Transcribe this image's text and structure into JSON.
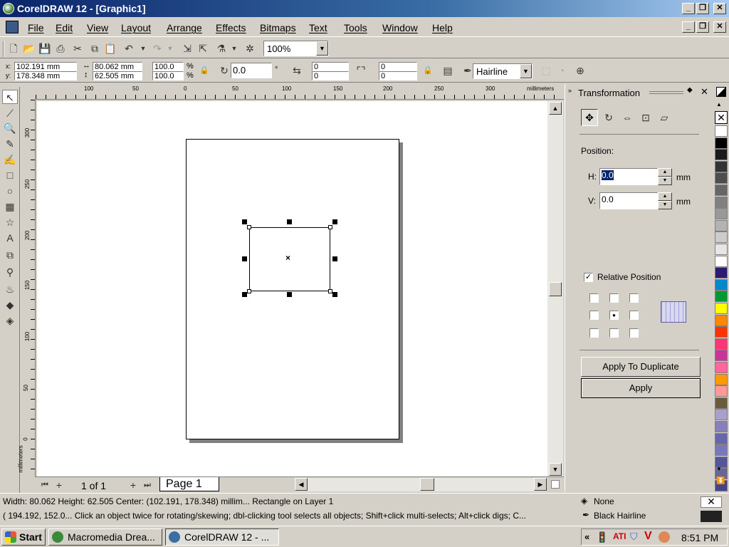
{
  "window": {
    "title": "CorelDRAW 12 - [Graphic1]"
  },
  "menu": [
    "File",
    "Edit",
    "View",
    "Layout",
    "Arrange",
    "Effects",
    "Bitmaps",
    "Text",
    "Tools",
    "Window",
    "Help"
  ],
  "toolbar": {
    "zoom": "100%"
  },
  "propbar": {
    "x": "102.191 mm",
    "y": "178.348 mm",
    "w": "80.062 mm",
    "h": "62.505 mm",
    "scale_x": "100.0",
    "scale_y": "100.0",
    "pct": "%",
    "rotation": "0.0",
    "degree": "°",
    "corner_a": "0",
    "corner_b": "0",
    "corner_c": "0",
    "corner_d": "0",
    "outline": "Hairline"
  },
  "ruler": {
    "h_ticks": [
      "100",
      "50",
      "0",
      "50",
      "100",
      "150",
      "200",
      "250",
      "300"
    ],
    "h_unit": "millimeters",
    "v_ticks": [
      "300",
      "250",
      "200",
      "150",
      "100",
      "50",
      "0"
    ],
    "v_unit": "millimeters"
  },
  "page_nav": {
    "counter": "1 of 1",
    "tab": "Page 1"
  },
  "docker": {
    "title": "Transformation",
    "position_label": "Position:",
    "h_label": "H:",
    "h_value": "0.0",
    "h_unit": "mm",
    "v_label": "V:",
    "v_value": "0.0",
    "v_unit": "mm",
    "relative_label": "Relative Position",
    "apply_dup": "Apply To Duplicate",
    "apply": "Apply"
  },
  "palette": [
    "#ffffff",
    "#000000",
    "#1a1a1a",
    "#333333",
    "#4d4d4d",
    "#666666",
    "#808080",
    "#999999",
    "#b3b3b3",
    "#cccccc",
    "#e6e6e6",
    "#ffffff",
    "#2e1a6e",
    "#0088cc",
    "#009933",
    "#ffff00",
    "#ff8800",
    "#ff3300",
    "#ff3377",
    "#cc3399",
    "#ff6699",
    "#ff9900",
    "#ff9999",
    "#6b5b3d",
    "#aaa0cc",
    "#8880bb",
    "#6666aa",
    "#7777bb",
    "#555599",
    "#666699",
    "#444488"
  ],
  "status": {
    "line1": "Width: 80.062  Height: 62.505  Center: (102.191, 178.348)  millim...  Rectangle on Layer 1",
    "line2": "( 194.192, 152.0...   Click an object twice for rotating/skewing; dbl-clicking tool selects all objects; Shift+click multi-selects; Alt+click digs; C...",
    "fill": "None",
    "outline": "Black  Hairline"
  },
  "taskbar": {
    "start": "Start",
    "tasks": [
      "Macromedia Drea...",
      "CorelDRAW 12 - ..."
    ],
    "time": "8:51 PM"
  }
}
